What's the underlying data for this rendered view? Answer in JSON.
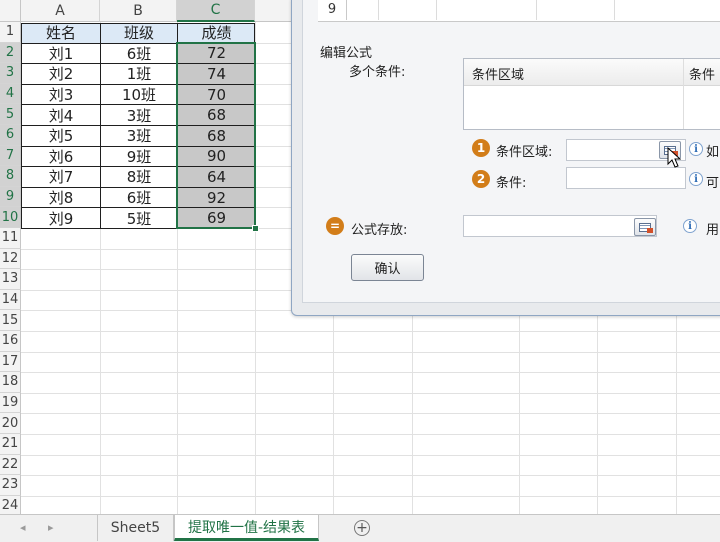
{
  "sheet": {
    "columns": [
      "A",
      "B",
      "C"
    ],
    "rows": [
      "1",
      "2",
      "3",
      "4",
      "5",
      "6",
      "7",
      "8",
      "9",
      "10",
      "11",
      "12",
      "13",
      "14",
      "15",
      "16",
      "17",
      "18",
      "19",
      "20",
      "21",
      "22",
      "23",
      "24"
    ],
    "table_header": [
      "姓名",
      "班级",
      "成绩"
    ],
    "table_rows": [
      [
        "刘1",
        "6班",
        "72"
      ],
      [
        "刘2",
        "1班",
        "74"
      ],
      [
        "刘3",
        "10班",
        "70"
      ],
      [
        "刘4",
        "3班",
        "68"
      ],
      [
        "刘5",
        "3班",
        "68"
      ],
      [
        "刘6",
        "9班",
        "90"
      ],
      [
        "刘7",
        "8班",
        "64"
      ],
      [
        "刘8",
        "6班",
        "92"
      ],
      [
        "刘9",
        "5班",
        "69"
      ]
    ]
  },
  "dialog": {
    "preview_row_number": "9",
    "section_title": "编辑公式",
    "multi_condition_label": "多个条件:",
    "list_col1": "条件区域",
    "list_col2": "条件",
    "step1_badge": "1",
    "step1_label": "条件区域:",
    "step1_hint": "如",
    "step2_badge": "2",
    "step2_label": "条件:",
    "step2_hint": "可",
    "result_badge": "=",
    "result_label": "公式存放:",
    "result_hint": "用",
    "ok_label": "确认"
  },
  "tabs": {
    "items": [
      "Sheet5",
      "提取唯一值-结果表"
    ],
    "active_index": 1,
    "add_label": "+"
  },
  "colors": {
    "accent": "#217346",
    "header_fill": "#dce9f6",
    "score_fill": "#c8c8c8",
    "badge_orange": "#d27d19"
  }
}
